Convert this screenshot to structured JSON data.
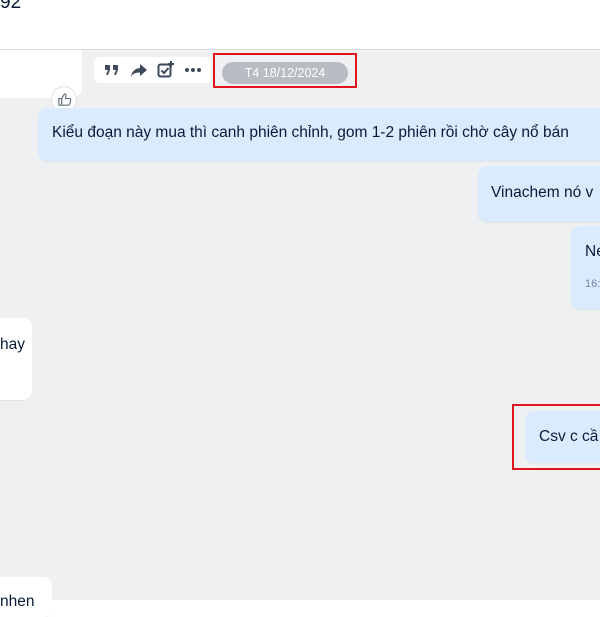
{
  "header": {
    "title_fragment": "92"
  },
  "toolbar": {
    "icons": [
      "quote-icon",
      "forward-icon",
      "add-task-icon",
      "more-options-icon"
    ]
  },
  "date_separator": {
    "label": "T4 18/12/2024"
  },
  "messages": [
    {
      "side": "out",
      "text": "Kiểu đoạn này mua thì canh phiên chỉnh, gom 1-2 phiên rồi chờ cây nổ bán"
    },
    {
      "side": "out",
      "text": "Vinachem nó v"
    },
    {
      "side": "out",
      "text": "Ne",
      "time": "16:"
    },
    {
      "side": "in",
      "text": "hay"
    },
    {
      "side": "out",
      "text": "Csv c cầ"
    },
    {
      "side": "in",
      "text": "nhen"
    }
  ],
  "colors": {
    "highlight": "#e0141e",
    "outgoing_bubble": "#dbebff",
    "chat_background": "#eef0f1",
    "date_pill": "#b9bcc2"
  }
}
